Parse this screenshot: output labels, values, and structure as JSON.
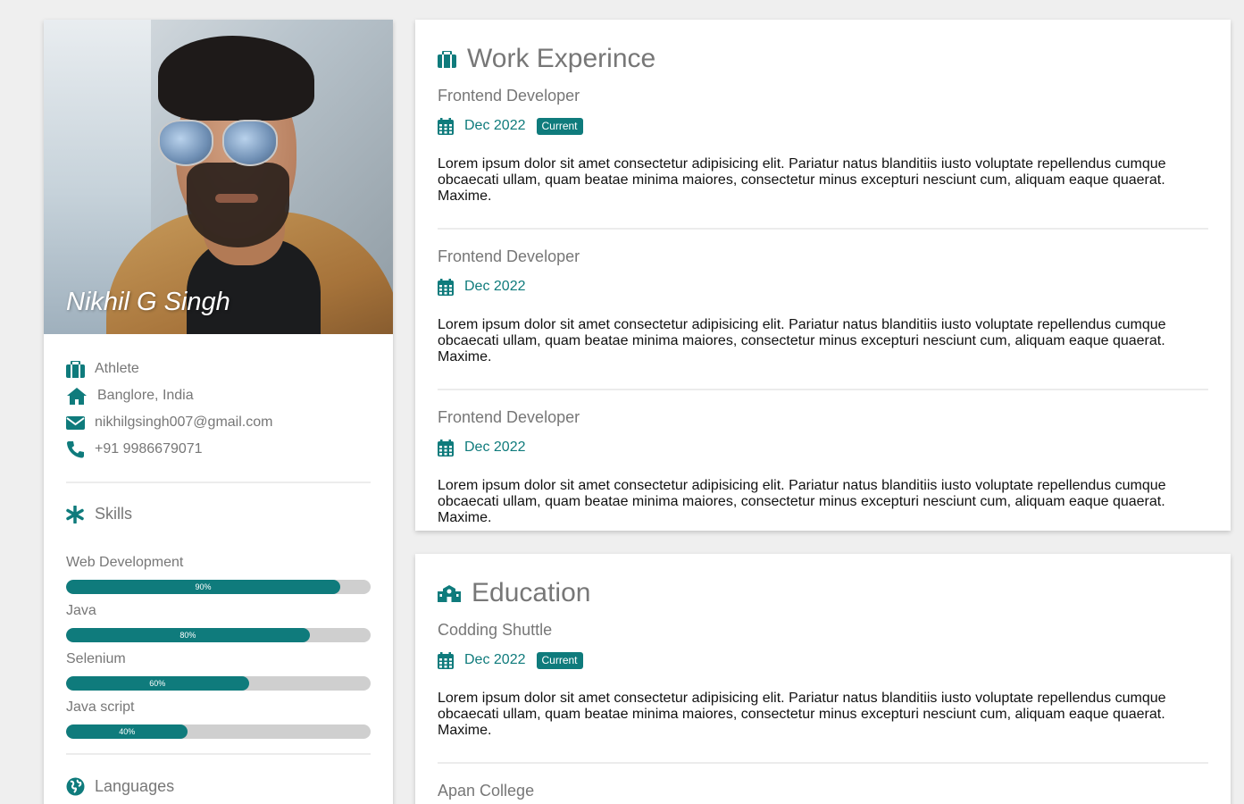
{
  "profile": {
    "name": "Nikhil G Singh",
    "occupation": "Athlete",
    "location": "Banglore, India",
    "email": "nikhilgsingh007@gmail.com",
    "phone": "+91 9986679071"
  },
  "skills": {
    "heading": "Skills",
    "items": [
      {
        "label": "Web Development",
        "percent_label": "90%",
        "level": 0.9
      },
      {
        "label": "Java",
        "percent_label": "80%",
        "level": 0.8
      },
      {
        "label": "Selenium",
        "percent_label": "60%",
        "level": 0.6
      },
      {
        "label": "Java script",
        "percent_label": "40%",
        "level": 0.4
      }
    ]
  },
  "languages": {
    "heading": "Languages"
  },
  "work": {
    "heading": "Work Experince",
    "entries": [
      {
        "title": "Frontend Developer",
        "date": "Dec 2022",
        "badge": "Current",
        "text": "Lorem ipsum dolor sit amet consectetur adipisicing elit. Pariatur natus blanditiis iusto voluptate repellendus cumque obcaecati ullam, quam beatae minima maiores, consectetur minus excepturi nesciunt cum, aliquam eaque quaerat. Maxime."
      },
      {
        "title": "Frontend Developer",
        "date": "Dec 2022",
        "text": "Lorem ipsum dolor sit amet consectetur adipisicing elit. Pariatur natus blanditiis iusto voluptate repellendus cumque obcaecati ullam, quam beatae minima maiores, consectetur minus excepturi nesciunt cum, aliquam eaque quaerat. Maxime."
      },
      {
        "title": "Frontend Developer",
        "date": "Dec 2022",
        "text": "Lorem ipsum dolor sit amet consectetur adipisicing elit. Pariatur natus blanditiis iusto voluptate repellendus cumque obcaecati ullam, quam beatae minima maiores, consectetur minus excepturi nesciunt cum, aliquam eaque quaerat. Maxime."
      }
    ]
  },
  "education": {
    "heading": "Education",
    "entries": [
      {
        "title": "Codding Shuttle",
        "date": "Dec 2022",
        "badge": "Current",
        "text": "Lorem ipsum dolor sit amet consectetur adipisicing elit. Pariatur natus blanditiis iusto voluptate repellendus cumque obcaecati ullam, quam beatae minima maiores, consectetur minus excepturi nesciunt cum, aliquam eaque quaerat. Maxime."
      },
      {
        "title": "Apan College"
      }
    ]
  },
  "icons": {
    "occupation": "briefcase-icon",
    "location": "home-icon",
    "email": "envelope-icon",
    "phone": "phone-icon",
    "skills": "asterisk-icon",
    "languages": "globe-icon",
    "work": "briefcase-icon",
    "education": "school-icon",
    "date": "calendar-icon"
  },
  "colors": {
    "accent": "#0f7b7c",
    "muted_text": "#777777",
    "page_bg": "#efefef"
  }
}
